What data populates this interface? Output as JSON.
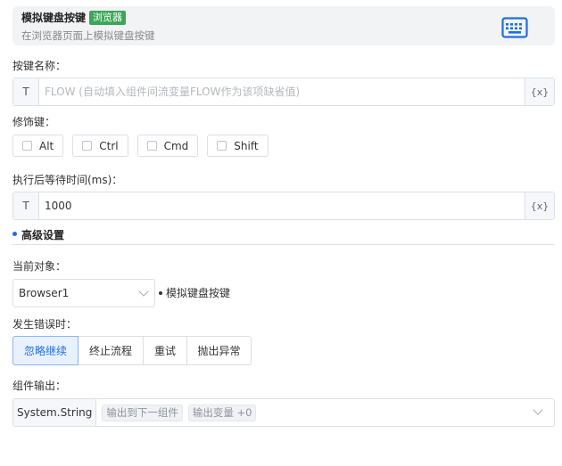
{
  "header": {
    "title": "模拟键盘按键",
    "badge": "浏览器",
    "description": "在浏览器页面上模拟键盘按键",
    "icon": "keyboard-icon"
  },
  "key_name": {
    "label": "按键名称：",
    "prefix": "T",
    "value": "",
    "placeholder": "FLOW (自动填入组件间流变量FLOW作为该项缺省值)",
    "suffix": "{x}"
  },
  "modifiers": {
    "label": "修饰键：",
    "options": [
      {
        "label": "Alt",
        "checked": false
      },
      {
        "label": "Ctrl",
        "checked": false
      },
      {
        "label": "Cmd",
        "checked": false
      },
      {
        "label": "Shift",
        "checked": false
      }
    ]
  },
  "wait_time": {
    "label": "执行后等待时间(ms)：",
    "prefix": "T",
    "value": "1000",
    "suffix": "{x}"
  },
  "advanced": {
    "title": "高级设置"
  },
  "target": {
    "label": "当前对象：",
    "selected": "Browser1",
    "note": "模拟键盘按键"
  },
  "on_error": {
    "label": "发生错误时：",
    "options": [
      "忽略继续",
      "终止流程",
      "重试",
      "抛出异常"
    ],
    "active_index": 0
  },
  "output": {
    "label": "组件输出：",
    "type": "System.String",
    "tags": [
      "输出到下一组件",
      "输出变量 +0"
    ]
  },
  "colors": {
    "accent": "#1e6fe0",
    "badge": "#3aa657"
  }
}
